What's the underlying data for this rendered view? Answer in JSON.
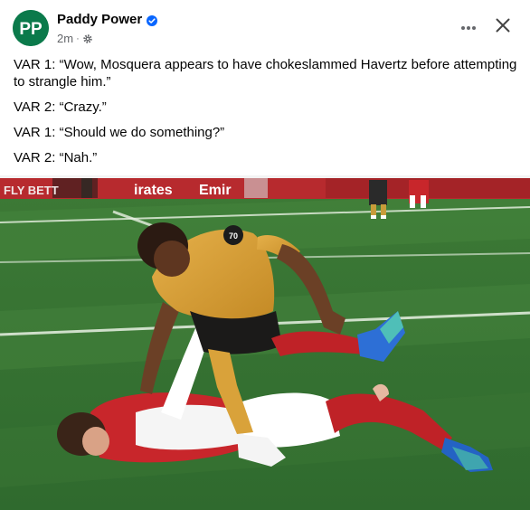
{
  "header": {
    "page_name": "Paddy Power",
    "timestamp": "2m",
    "separator": "·",
    "avatar_text": "PP"
  },
  "post": {
    "lines": [
      "VAR 1: “Wow, Mosquera appears to have chokeslammed Havertz before attempting to strangle him.”",
      "VAR 2: “Crazy.”",
      "VAR 1: “Should we do something?”",
      "VAR 2: “Nah.”"
    ]
  },
  "media": {
    "boards": [
      "FLY BETT",
      "irates",
      "Emir"
    ],
    "shirt_number": "70"
  },
  "icons": [
    "verified-badge-icon",
    "gear-icon",
    "more-icon",
    "close-icon"
  ],
  "colors": {
    "brand_green": "#0b7a4b",
    "verified_blue": "#0866ff",
    "pitch_green": "#3f7f3a",
    "wolves_gold": "#d9a23a",
    "arsenal_red": "#c8262b"
  }
}
